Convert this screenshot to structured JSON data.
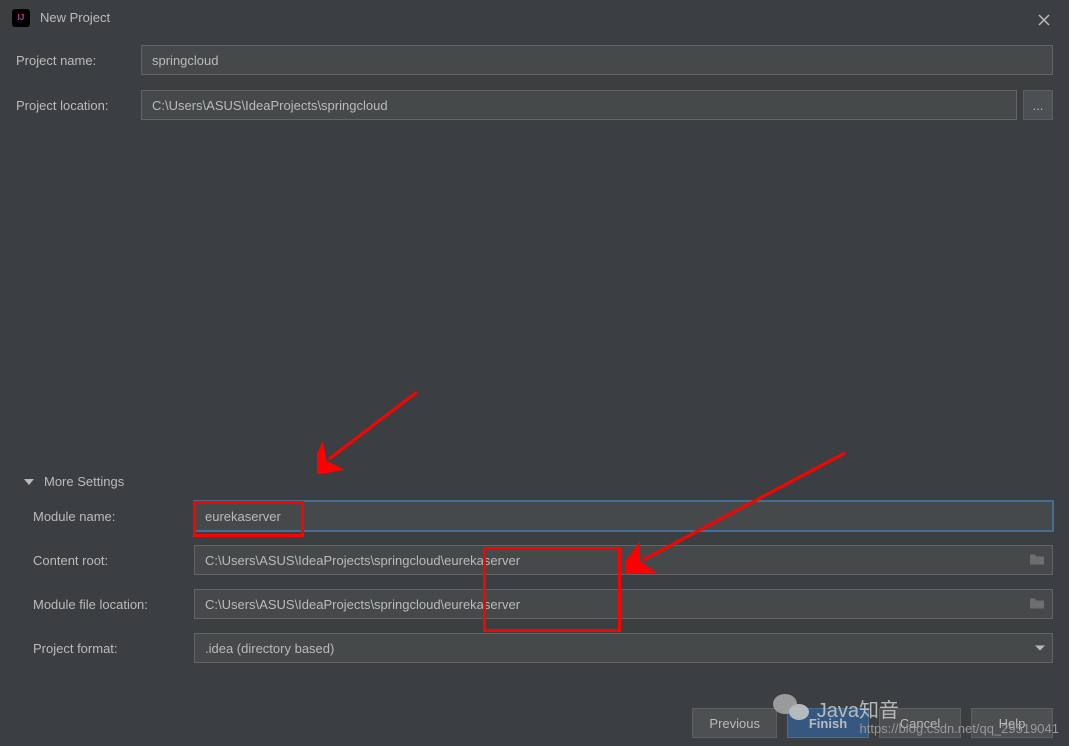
{
  "titlebar": {
    "title": "New Project"
  },
  "form": {
    "project_name_label": "Project name:",
    "project_name_value": "springcloud",
    "project_location_label": "Project location:",
    "project_location_value": "C:\\Users\\ASUS\\IdeaProjects\\springcloud",
    "browse_label": "..."
  },
  "more_settings": {
    "header": "More Settings",
    "module_name_label": "Module name:",
    "module_name_value": "eurekaserver",
    "content_root_label": "Content root:",
    "content_root_value": "C:\\Users\\ASUS\\IdeaProjects\\springcloud\\eurekaserver",
    "module_file_location_label": "Module file location:",
    "module_file_location_value": "C:\\Users\\ASUS\\IdeaProjects\\springcloud\\eurekaserver",
    "project_format_label": "Project format:",
    "project_format_value": ".idea (directory based)"
  },
  "buttons": {
    "previous": "Previous",
    "finish": "Finish",
    "cancel": "Cancel",
    "help": "Help"
  },
  "watermark": {
    "text": "Java知音",
    "url": "https://blog.csdn.net/qq_29519041"
  }
}
